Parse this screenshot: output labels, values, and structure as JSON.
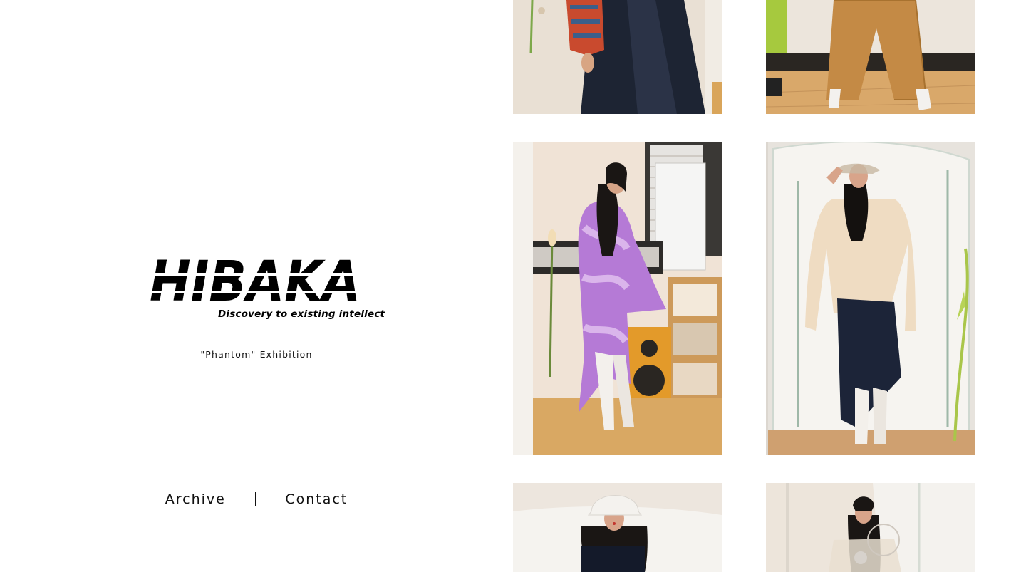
{
  "brand": {
    "logo_text": "HIBAKA",
    "tagline": "Discovery to existing intellect"
  },
  "exhibition": {
    "label": "\"Phantom\" Exhibition"
  },
  "nav": {
    "archive_label": "Archive",
    "contact_label": "Contact"
  },
  "gallery": {
    "photos": [
      {
        "name": "look-top-left",
        "description": "black skirt with patterned knit sleeve"
      },
      {
        "name": "look-top-right",
        "description": "tan wide trousers with white boots"
      },
      {
        "name": "look-purple-tiedye",
        "description": "purple tie-dye tunic dress"
      },
      {
        "name": "look-beige-top",
        "description": "beige top with navy skirt"
      },
      {
        "name": "look-bucket-hat",
        "description": "white bucket hat and navy top"
      },
      {
        "name": "look-sheer-jacket",
        "description": "sheer beige jacket"
      }
    ]
  },
  "colors": {
    "background": "#ffffff",
    "text": "#111111"
  }
}
